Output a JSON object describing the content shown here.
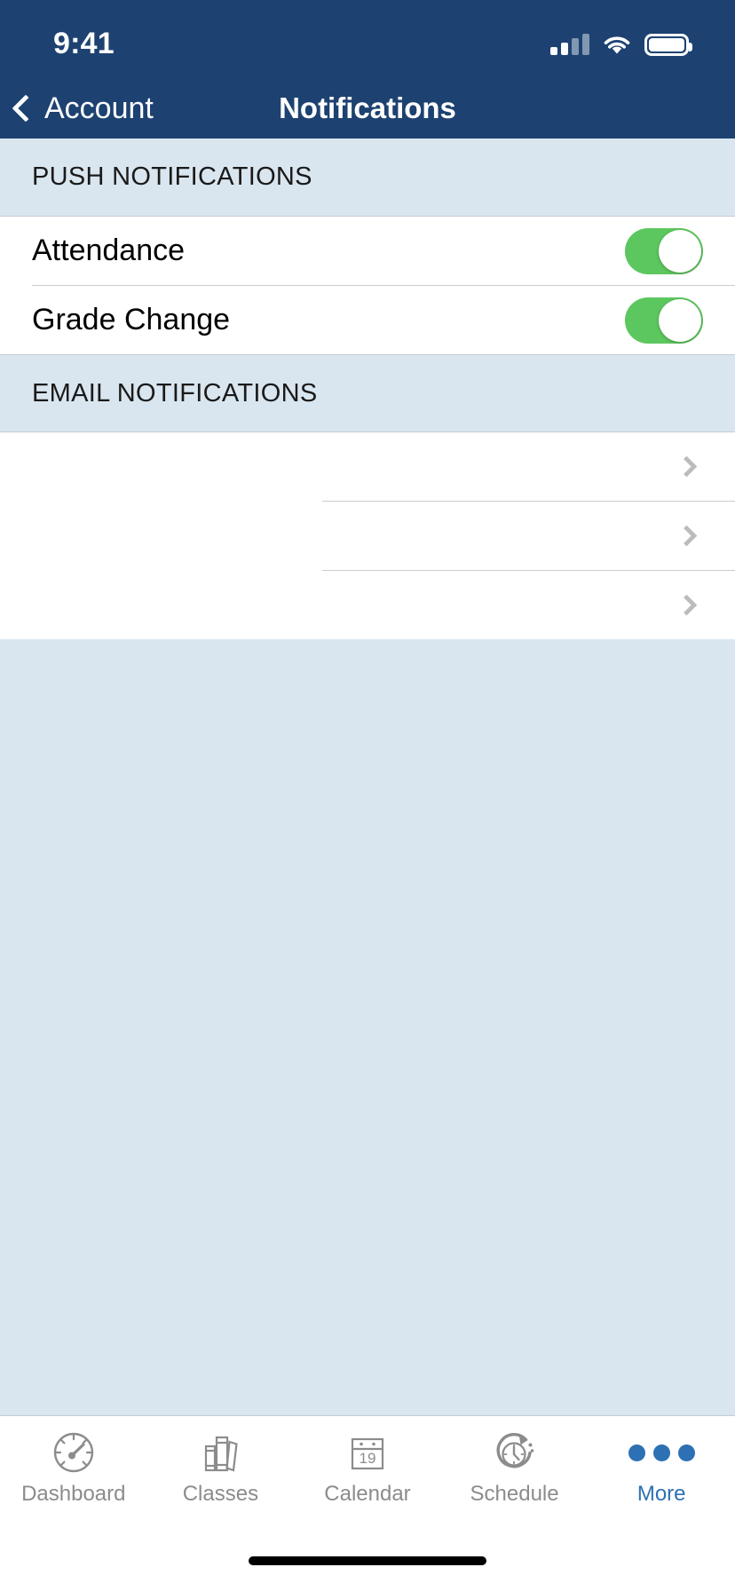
{
  "status_bar": {
    "time": "9:41",
    "signal_icon": "cellular-signal-icon",
    "wifi_icon": "wifi-icon",
    "battery_icon": "battery-icon"
  },
  "nav_bar": {
    "back_label": "Account",
    "back_icon": "chevron-left-icon",
    "title": "Notifications"
  },
  "colors": {
    "nav_background": "#1d4271",
    "section_background": "#dae6ef",
    "toggle_on": "#5cc75e",
    "accent": "#2d70b3",
    "chevron": "#bcbcbc",
    "separator": "#c8cdd1"
  },
  "sections": [
    {
      "header": "PUSH NOTIFICATIONS",
      "rows": [
        {
          "label": "Attendance",
          "control": "toggle",
          "value": "on"
        },
        {
          "label": "Grade Change",
          "control": "toggle",
          "value": "on"
        }
      ]
    },
    {
      "header": "EMAIL NOTIFICATIONS",
      "rows": [
        {
          "label": "",
          "control": "disclosure",
          "icon": "chevron-right-icon"
        },
        {
          "label": "",
          "control": "disclosure",
          "icon": "chevron-right-icon"
        },
        {
          "label": "",
          "control": "disclosure",
          "icon": "chevron-right-icon"
        }
      ]
    }
  ],
  "tab_bar": {
    "tabs": [
      {
        "label": "Dashboard",
        "icon": "gauge-icon",
        "active": false
      },
      {
        "label": "Classes",
        "icon": "books-icon",
        "active": false
      },
      {
        "label": "Calendar",
        "icon": "calendar-icon",
        "active": false,
        "day": "19"
      },
      {
        "label": "Schedule",
        "icon": "clock-arrow-icon",
        "active": false
      },
      {
        "label": "More",
        "icon": "ellipsis-icon",
        "active": true
      }
    ]
  }
}
